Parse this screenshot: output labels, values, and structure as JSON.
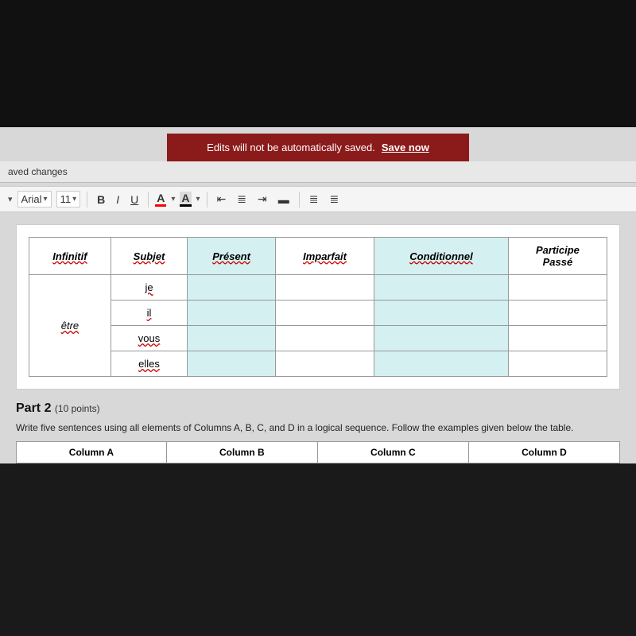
{
  "top": {
    "background": "black"
  },
  "banner": {
    "message": "Edits will not be automatically saved.",
    "save_label": "Save now",
    "bg_color": "#8b1a1a"
  },
  "header": {
    "unsaved_label": "aved changes"
  },
  "toolbar": {
    "font_name": "Arial",
    "font_size": "11",
    "bold_label": "B",
    "italic_label": "I",
    "underline_label": "U",
    "color_a_label": "A",
    "color_a2_label": "A",
    "dropdown_arrow": "▾"
  },
  "table": {
    "headers": [
      "Infinitif",
      "Subjet",
      "Présent",
      "Imparfait",
      "Conditionnel",
      "Participe\nPassé"
    ],
    "rows": [
      {
        "infinitif": "être",
        "subjects": [
          "je",
          "il",
          "vous",
          "elles"
        ]
      }
    ]
  },
  "part2": {
    "title": "Part 2",
    "points": "(10 points)",
    "description": "Write five sentences using all elements of Columns A, B, C, and D in a logical sequence. Follow the examples given below the table.",
    "columns": [
      "Column A",
      "Column B",
      "Column C",
      "Column D"
    ]
  }
}
